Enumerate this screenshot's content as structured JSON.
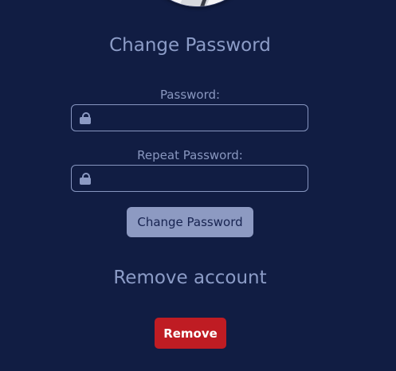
{
  "change_password": {
    "title": "Change Password",
    "password_label": "Password:",
    "password_value": "",
    "repeat_label": "Repeat Password:",
    "repeat_value": "",
    "button_label": "Change Password",
    "field_icon": "lock-icon"
  },
  "remove_account": {
    "title": "Remove account",
    "button_label": "Remove",
    "button_color": "#bf1c23"
  },
  "theme": {
    "background": "#111d43",
    "accent": "#8d9ac2"
  }
}
